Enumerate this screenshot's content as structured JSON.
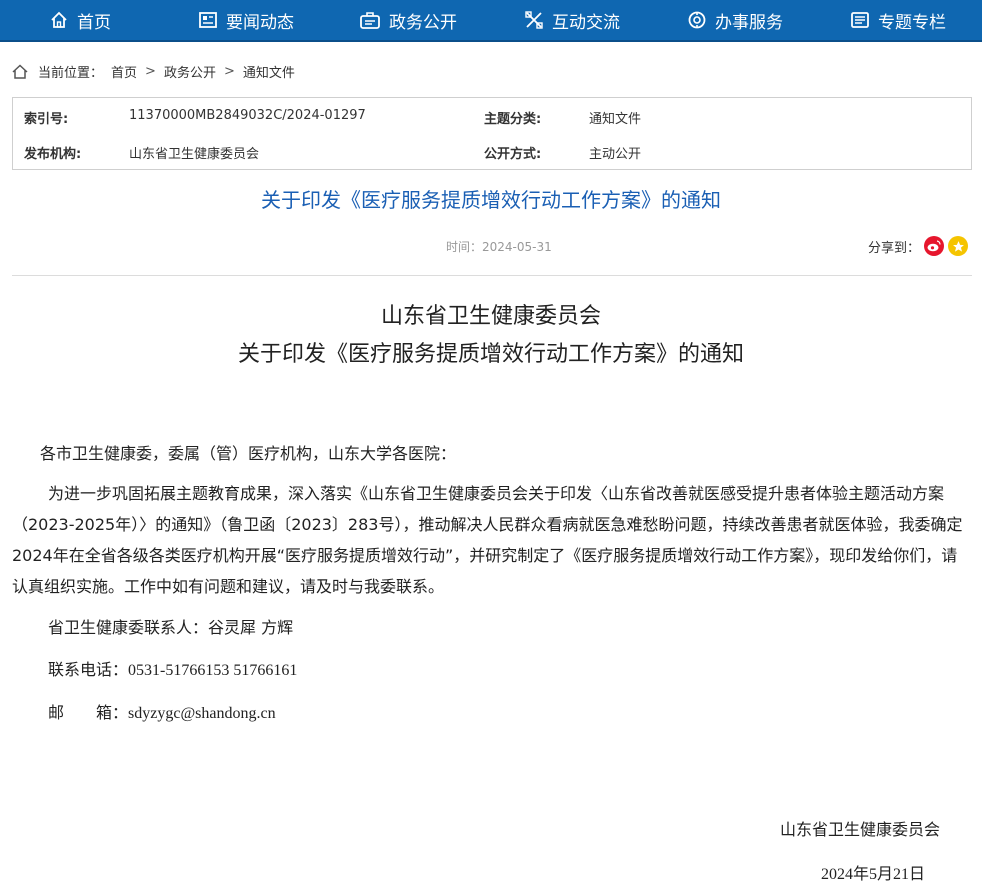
{
  "nav": {
    "items": [
      {
        "label": "首页",
        "icon": "home-icon"
      },
      {
        "label": "要闻动态",
        "icon": "news-icon"
      },
      {
        "label": "政务公开",
        "icon": "briefcase-icon"
      },
      {
        "label": "互动交流",
        "icon": "interaction-icon"
      },
      {
        "label": "办事服务",
        "icon": "service-icon"
      },
      {
        "label": "专题专栏",
        "icon": "column-icon"
      }
    ]
  },
  "breadcrumb": {
    "prefix": "当前位置：",
    "items": [
      "首页",
      "政务公开",
      "通知文件"
    ],
    "separator": ">"
  },
  "meta": {
    "index_label": "索引号:",
    "index_value": "11370000MB2849032C/2024-01297",
    "category_label": "主题分类:",
    "category_value": "通知文件",
    "publisher_label": "发布机构:",
    "publisher_value": "山东省卫生健康委员会",
    "disclosure_label": "公开方式:",
    "disclosure_value": "主动公开"
  },
  "article": {
    "title": "关于印发《医疗服务提质增效行动工作方案》的通知",
    "date_text": "时间：2024-05-31",
    "share_label": "分享到：",
    "heading_line1": "山东省卫生健康委员会",
    "heading_line2": "关于印发《医疗服务提质增效行动工作方案》的通知",
    "salutation": "各市卫生健康委，委属（管）医疗机构，山东大学各医院：",
    "body": "为进一步巩固拓展主题教育成果，深入落实《山东省卫生健康委员会关于印发〈山东省改善就医感受提升患者体验主题活动方案（2023-2025年）〉的通知》（鲁卫函〔2023〕283号），推动解决人民群众看病就医急难愁盼问题，持续改善患者就医体验，我委确定2024年在全省各级各类医疗机构开展“医疗服务提质增效行动”，并研究制定了《医疗服务提质增效行动工作方案》，现印发给你们，请认真组织实施。工作中如有问题和建议，请及时与我委联系。",
    "contact_label": "省卫生健康委联系人：",
    "contact_value": "谷灵犀 方辉",
    "phone_label": "联系电话：",
    "phone_value": "0531-51766153 51766161",
    "email_label": "邮　　箱：",
    "email_value": "sdyzygc@shandong.cn",
    "signature": "山东省卫生健康委员会",
    "sign_date": "2024年5月21日"
  },
  "colors": {
    "nav_bg": "#0f67b1",
    "title_blue": "#1a5fb4",
    "weibo_red": "#e6162d",
    "favorite_yellow": "#f5c400"
  }
}
